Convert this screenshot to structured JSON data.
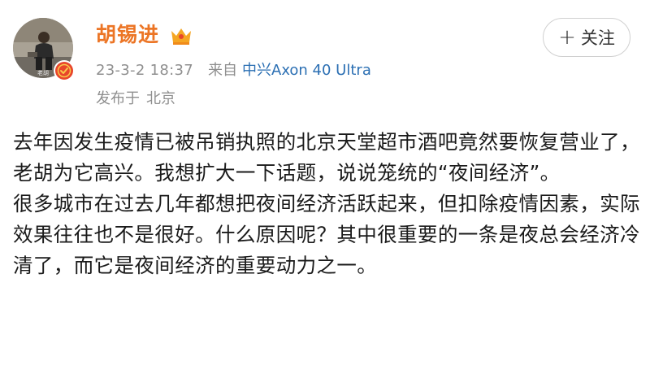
{
  "user": {
    "name": "胡锡进",
    "avatar_icon": "user-avatar-photo",
    "verified_icon": "verified-badge-icon",
    "vip_icon": "vip-crown-icon"
  },
  "meta": {
    "date": "23-3-2 18:37",
    "from_label": "来自",
    "device": "中兴Axon 40 Ultra",
    "location_label": "发布于",
    "location": "北京"
  },
  "follow": {
    "icon": "+",
    "label": "关注"
  },
  "post": {
    "paragraphs": [
      "去年因发生疫情已被吊销执照的北京天堂超市酒吧竟然要恢复营业了，老胡为它高兴。我想扩大一下话题，说说笼统的“夜间经济”。",
      "很多城市在过去几年都想把夜间经济活跃起来，但扣除疫情因素，实际效果往往也不是很好。什么原因呢？其中很重要的一条是夜总会经济冷清了，而它是夜间经济的重要动力之一。"
    ]
  },
  "colors": {
    "name": "#ec7525",
    "device_link": "#2b6fb3",
    "meta": "#8f8f8f",
    "verified": "#e8462b",
    "vip": "#f5a623"
  }
}
